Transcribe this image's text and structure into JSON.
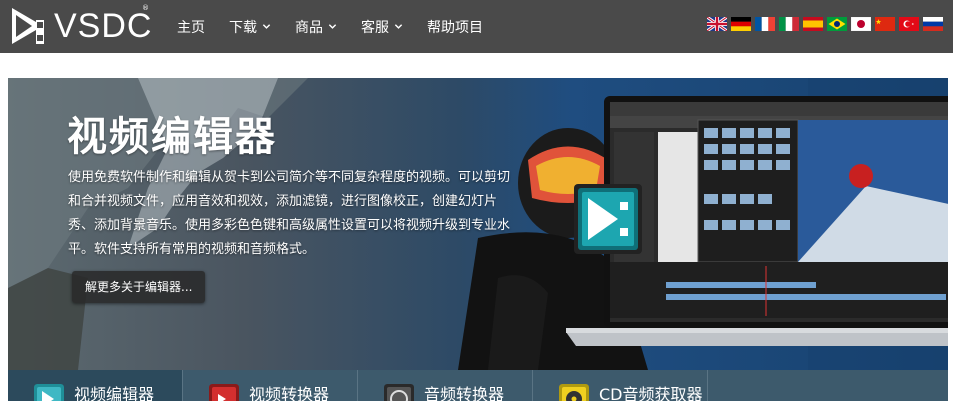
{
  "brand": {
    "name": "VSDC",
    "registered": "®"
  },
  "nav": {
    "items": [
      {
        "label": "主页",
        "dropdown": false
      },
      {
        "label": "下载",
        "dropdown": true
      },
      {
        "label": "商品",
        "dropdown": true
      },
      {
        "label": "客服",
        "dropdown": true
      },
      {
        "label": "帮助项目",
        "dropdown": false
      }
    ]
  },
  "languages": [
    "English",
    "Deutsch",
    "Français",
    "Italiano",
    "Español",
    "Português",
    "日本語",
    "中文",
    "Türkçe",
    "Русский"
  ],
  "hero": {
    "title": "视频编辑器",
    "description": "使用免费软件制作和编辑从贺卡到公司简介等不同复杂程度的视频。可以剪切和合并视频文件，应用音效和视效，添加滤镜，进行图像校正，创建幻灯片秀、添加背景音乐。使用多彩色色键和高级属性设置可以将视频升级到专业水平。软件支持所有常用的视频和音频格式。",
    "button_label": "解更多关于编辑器..."
  },
  "tabs": [
    {
      "label": "视频编辑器",
      "icon": "video-editor-icon",
      "color": "#3fb8c4",
      "active": true
    },
    {
      "label": "视频转换器",
      "icon": "video-converter-icon",
      "color": "#d32f2f",
      "active": false
    },
    {
      "label": "音频转换器",
      "icon": "audio-converter-icon",
      "color": "#555555",
      "active": false
    },
    {
      "label": "CD音频获取器",
      "icon": "cd-grabber-icon",
      "color": "#f0d020",
      "active": false
    }
  ],
  "colors": {
    "topbar": "#4a4a4a",
    "tabbar": "#3d5a6c",
    "accent": "#3fb8c4"
  }
}
